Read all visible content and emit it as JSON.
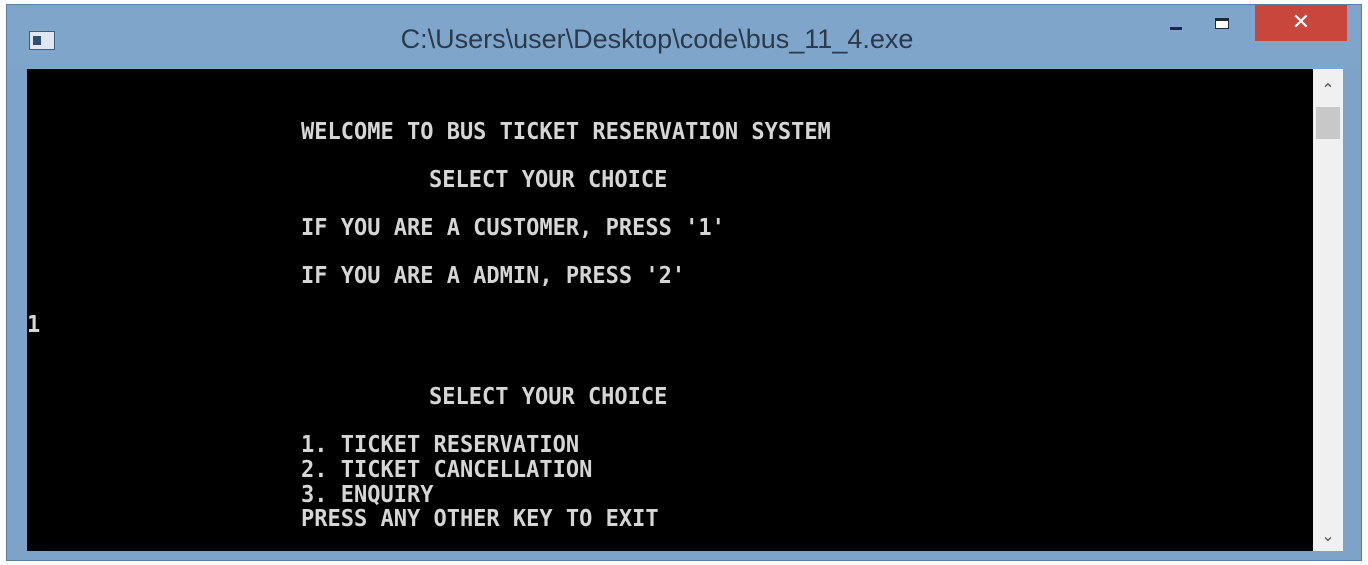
{
  "window": {
    "title": "C:\\Users\\user\\Desktop\\code\\bus_11_4.exe",
    "close_glyph": "✕",
    "minimize_icon": "minimize-icon",
    "maximize_icon": "maximize-icon",
    "app_icon": "console-app-icon"
  },
  "console": {
    "lines": [
      "WELCOME TO BUS TICKET RESERVATION SYSTEM",
      "SELECT YOUR CHOICE",
      "IF YOU ARE A CUSTOMER, PRESS '1'",
      "IF YOU ARE A ADMIN, PRESS '2'",
      "1",
      "SELECT YOUR CHOICE",
      "1. TICKET RESERVATION",
      "2. TICKET CANCELLATION",
      "3. ENQUIRY",
      "PRESS ANY OTHER KEY TO EXIT"
    ]
  },
  "scrollbar": {
    "up_glyph": "⌃",
    "down_glyph": "⌄"
  },
  "colors": {
    "titlebar": "#7fa6ca",
    "console_bg": "#000000",
    "console_text": "#d6d6d6",
    "close_button": "#c9463c"
  }
}
